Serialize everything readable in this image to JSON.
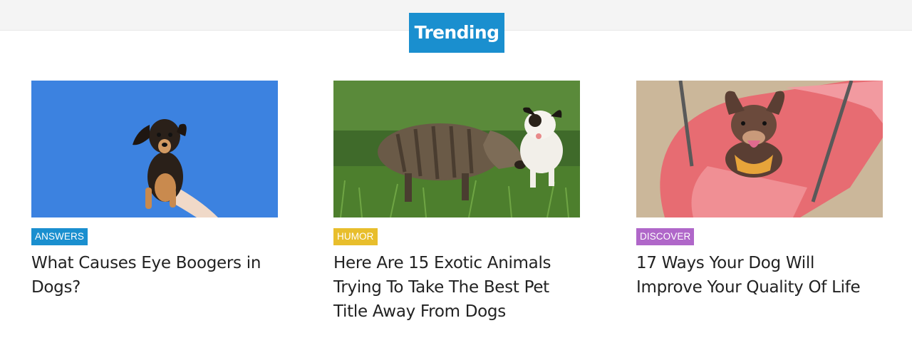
{
  "section": {
    "title": "Trending"
  },
  "colors": {
    "title_bg": "#1a8fcf",
    "answers": "#1a8fcf",
    "humor": "#e8be2c",
    "discover": "#b067c9"
  },
  "articles": [
    {
      "category": "ANSWERS",
      "category_color": "#1a8fcf",
      "title": "What Causes Eye Boogers in Dogs?",
      "image": "puppy-on-blue-background"
    },
    {
      "category": "HUMOR",
      "category_color": "#e8be2c",
      "title": "Here Are 15 Exotic Animals Trying To Take The Best Pet Title Away From Dogs",
      "image": "boar-piglet-and-puppy-in-grass"
    },
    {
      "category": "DISCOVER",
      "category_color": "#b067c9",
      "title": "17 Ways Your Dog Will Improve Your Quality Of Life",
      "image": "chihuahua-on-pink-swing"
    }
  ]
}
